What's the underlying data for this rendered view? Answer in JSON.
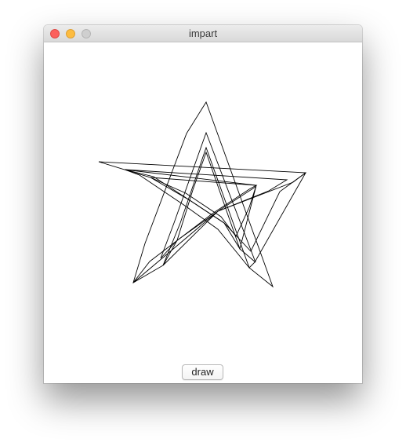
{
  "window": {
    "title": "impart"
  },
  "toolbar": {
    "draw_label": "draw"
  },
  "colors": {
    "close": "#fc605c",
    "minimize": "#fdbc40",
    "zoom": "#cfcfcf",
    "stroke": "#000000",
    "canvas": "#ffffff"
  },
  "icons": {
    "close": "close-traffic-light-icon",
    "minimize": "minimize-traffic-light-icon",
    "zoom": "zoom-traffic-light-icon"
  }
}
